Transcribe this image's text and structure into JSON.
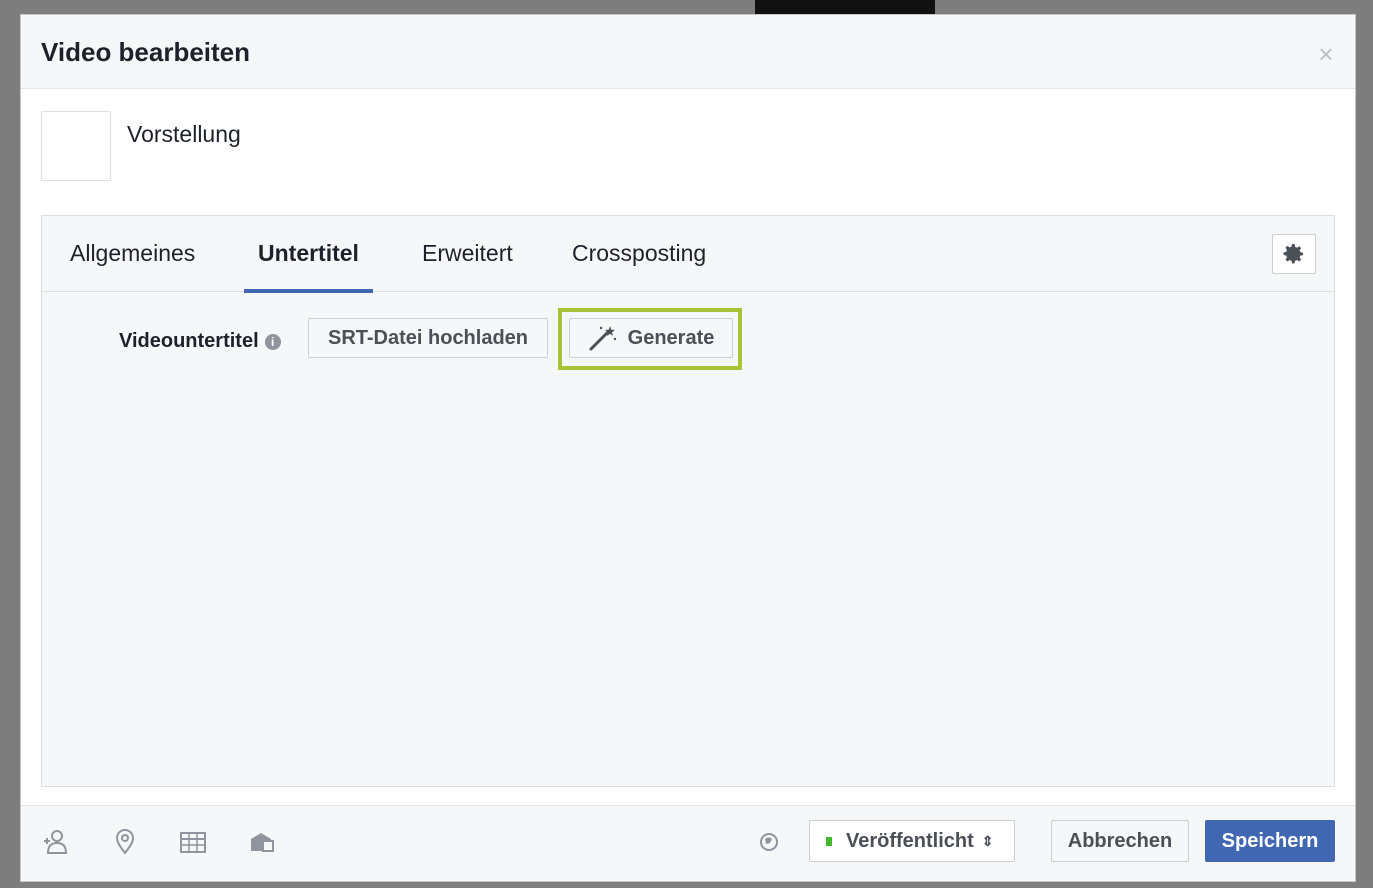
{
  "dialog": {
    "title": "Video bearbeiten",
    "close_icon": "close-icon"
  },
  "video": {
    "name": "Vorstellung"
  },
  "tabs": [
    {
      "label": "Allgemeines",
      "active": false
    },
    {
      "label": "Untertitel",
      "active": true
    },
    {
      "label": "Erweitert",
      "active": false
    },
    {
      "label": "Crossposting",
      "active": false
    }
  ],
  "subtitles": {
    "label": "Videountertitel",
    "upload_button": "SRT-Datei hochladen",
    "generate_button": "Generate",
    "highlight_color": "#a6c436"
  },
  "footer": {
    "icons": [
      "tag-person-icon",
      "location-icon",
      "calendar-icon",
      "product-icon"
    ],
    "audience_icon": "globe-icon",
    "status": "Veröffentlicht",
    "status_color": "#42b72a",
    "cancel_button": "Abbrechen",
    "save_button": "Speichern",
    "accent_color": "#4267b2"
  }
}
